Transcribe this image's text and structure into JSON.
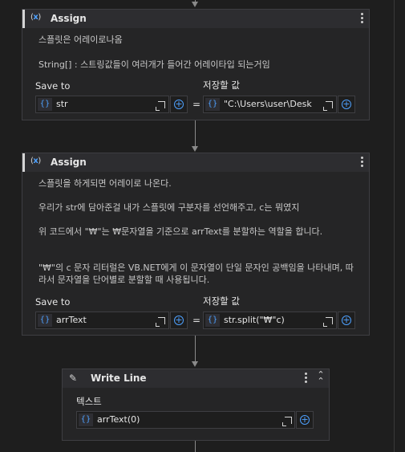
{
  "assign1": {
    "title": "Assign",
    "icon": "assign-icon",
    "notes": [
      "스플릿은 어레이로나옴",
      "String[] : 스트링값들이 여러개가 들어간 어레이타입 되는거임"
    ],
    "save_to_label": "Save to",
    "value_label": "저장할 값",
    "save_to_value": "str",
    "value": "\"C:\\Users\\user\\Desk",
    "equals": "="
  },
  "assign2": {
    "title": "Assign",
    "icon": "assign-icon",
    "notes": [
      "스플릿을 하게되면 어레이로 나온다.",
      "우리가 str에 담아준걸 내가 스플릿에 구분자를 선언해주고, c는 뭐였지",
      "위 코드에서 \"₩\"는 ₩문자열을 기준으로 arrText를 분할하는 역할을 합니다.",
      "\"₩\"의 c 문자 리터럴은 VB.NET에게 이 문자열이 단일 문자인 공백임을 나타내며, 따라서 문자열을 단어별로 분할할 때 사용됩니다."
    ],
    "save_to_label": "Save to",
    "value_label": "저장할 값",
    "save_to_value": "arrText",
    "value": "str.split(\"₩\"c)",
    "equals": "="
  },
  "writeline": {
    "title": "Write Line",
    "icon": "write-line-icon",
    "text_label": "텍스트",
    "text_value": "arrText(0)"
  },
  "vb_badge": "{}",
  "plus": "+"
}
